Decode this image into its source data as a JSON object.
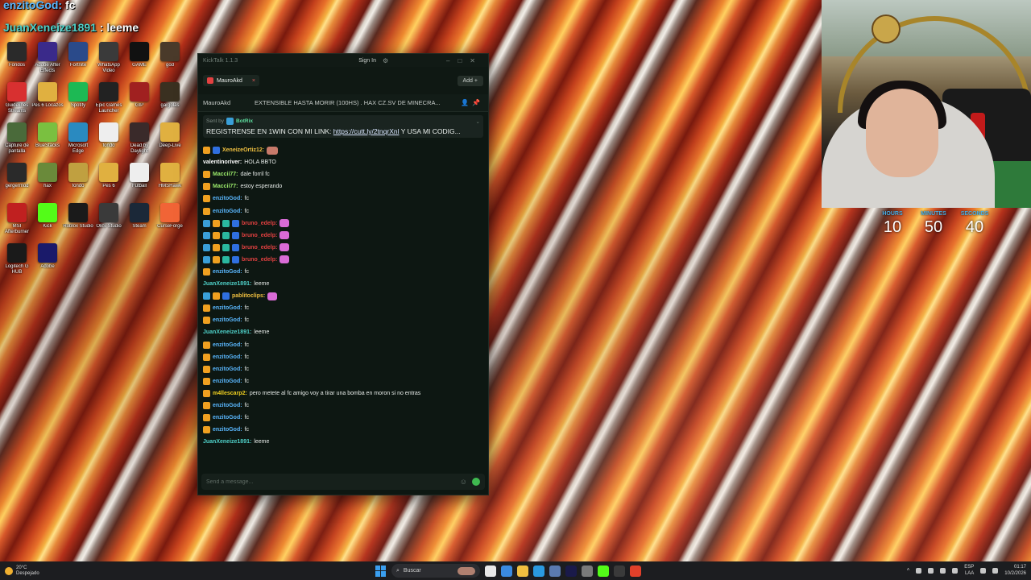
{
  "overlay": {
    "name1": "enzitoGod:",
    "name1_rest": "fc",
    "name2": "JuanXeneize1891",
    "name2_rest": ": leeme"
  },
  "chat": {
    "app_title": "KickTalk 1.1.3",
    "sign_in": "Sign In",
    "tab_label": "MauroAkd",
    "add_label": "Add +",
    "channel": "MauroAkd",
    "stream_title": "EXTENSIBLE HASTA MORIR (100HS) . HAX CZ.SV DE MINECRA...",
    "pinned": {
      "sent_by": "Sent by",
      "user": "BotRix",
      "text_before": "REGISTRENSE EN 1WIN CON MI LINK:",
      "link": "https://cutt.ly/2tnqrXnl",
      "text_after": "Y USA MI CODIG..."
    },
    "messages": [
      {
        "user": "XeneizeOrtiz12:",
        "text": "",
        "color": "#f0c040",
        "badges": [
          "crown",
          "gem"
        ],
        "emote": "face"
      },
      {
        "user": "valentinoriver:",
        "text": "HOLA BBTO",
        "color": "#ffffff",
        "badges": [],
        "emote": ""
      },
      {
        "user": "Maccii77:",
        "text": "dale forril fc",
        "color": "#9ae86a",
        "badges": [
          "crown"
        ],
        "emote": ""
      },
      {
        "user": "Maccii77:",
        "text": "estoy esperando",
        "color": "#9ae86a",
        "badges": [
          "crown"
        ],
        "emote": ""
      },
      {
        "user": "enzitoGod:",
        "text": "fc",
        "color": "#5ab8ff",
        "badges": [
          "crown"
        ],
        "emote": ""
      },
      {
        "user": "enzitoGod:",
        "text": "fc",
        "color": "#5ab8ff",
        "badges": [
          "crown"
        ],
        "emote": ""
      },
      {
        "user": "bruno_edelp:",
        "text": "",
        "color": "#e04040",
        "badges": [
          "blue",
          "crown",
          "teal",
          "gem"
        ],
        "emote": "pink"
      },
      {
        "user": "bruno_edelp:",
        "text": "",
        "color": "#e04040",
        "badges": [
          "blue",
          "crown",
          "teal",
          "gem"
        ],
        "emote": "pink"
      },
      {
        "user": "bruno_edelp:",
        "text": "",
        "color": "#e04040",
        "badges": [
          "blue",
          "crown",
          "teal",
          "gem"
        ],
        "emote": "pink"
      },
      {
        "user": "bruno_edelp:",
        "text": "",
        "color": "#e04040",
        "badges": [
          "blue",
          "crown",
          "teal",
          "gem"
        ],
        "emote": "pink"
      },
      {
        "user": "enzitoGod:",
        "text": "fc",
        "color": "#5ab8ff",
        "badges": [
          "crown"
        ],
        "emote": ""
      },
      {
        "user": "JuanXeneize1891:",
        "text": "leeme",
        "color": "#4fd0c8",
        "badges": [],
        "emote": ""
      },
      {
        "user": "pablitoclips:",
        "text": "",
        "color": "#f0c040",
        "badges": [
          "blue",
          "crown",
          "gem"
        ],
        "emote": "pink"
      },
      {
        "user": "enzitoGod:",
        "text": "fc",
        "color": "#5ab8ff",
        "badges": [
          "crown"
        ],
        "emote": ""
      },
      {
        "user": "enzitoGod:",
        "text": "fc",
        "color": "#5ab8ff",
        "badges": [
          "crown"
        ],
        "emote": ""
      },
      {
        "user": "JuanXeneize1891:",
        "text": "leeme",
        "color": "#4fd0c8",
        "badges": [],
        "emote": ""
      },
      {
        "user": "enzitoGod:",
        "text": "fc",
        "color": "#5ab8ff",
        "badges": [
          "crown"
        ],
        "emote": ""
      },
      {
        "user": "enzitoGod:",
        "text": "fc",
        "color": "#5ab8ff",
        "badges": [
          "crown"
        ],
        "emote": ""
      },
      {
        "user": "enzitoGod:",
        "text": "fc",
        "color": "#5ab8ff",
        "badges": [
          "crown"
        ],
        "emote": ""
      },
      {
        "user": "enzitoGod:",
        "text": "fc",
        "color": "#5ab8ff",
        "badges": [
          "crown"
        ],
        "emote": ""
      },
      {
        "user": "m4llescarp2:",
        "text": "pero metete al fc amigo voy a tirar una bomba en moron si no entras",
        "color": "#f0d020",
        "badges": [
          "crown"
        ],
        "emote": ""
      },
      {
        "user": "enzitoGod:",
        "text": "fc",
        "color": "#5ab8ff",
        "badges": [
          "crown"
        ],
        "emote": ""
      },
      {
        "user": "enzitoGod:",
        "text": "fc",
        "color": "#5ab8ff",
        "badges": [
          "crown"
        ],
        "emote": ""
      },
      {
        "user": "enzitoGod:",
        "text": "fc",
        "color": "#5ab8ff",
        "badges": [
          "crown"
        ],
        "emote": ""
      },
      {
        "user": "JuanXeneize1891:",
        "text": "leeme",
        "color": "#4fd0c8",
        "badges": [],
        "emote": ""
      }
    ],
    "input_placeholder": "Send a message..."
  },
  "timer": {
    "hours_label": "HOURS",
    "hours": "10",
    "minutes_label": "MINUTES",
    "minutes": "50",
    "seconds_label": "SECONDS",
    "seconds": "40"
  },
  "desktop_icons": [
    {
      "label": "Fondos",
      "color": "#2a2a2a"
    },
    {
      "label": "Adobe After Effects",
      "color": "#3a2a8a"
    },
    {
      "label": "Fortnite",
      "color": "#2a4a8a"
    },
    {
      "label": "WhatsApp Video",
      "color": "#3a3a3a"
    },
    {
      "label": "GAME",
      "color": "#111111"
    },
    {
      "label": "god",
      "color": "#4a3a2a"
    },
    {
      "label": "Guidelines Streams",
      "color": "#d83030"
    },
    {
      "label": "Pes 6 Locazos",
      "color": "#e0b040"
    },
    {
      "label": "Spotify",
      "color": "#1db954"
    },
    {
      "label": "Epic Games Launcher",
      "color": "#222222"
    },
    {
      "label": "GIP",
      "color": "#a02020"
    },
    {
      "label": "gargolas",
      "color": "#3a3020"
    },
    {
      "label": "Capture de pantalla",
      "color": "#4a6a3a"
    },
    {
      "label": "BlueStacks",
      "color": "#7ac040"
    },
    {
      "label": "Microsoft Edge",
      "color": "#2a8ac0"
    },
    {
      "label": "fondo",
      "color": "#eeeeee"
    },
    {
      "label": "Dead by Daylight",
      "color": "#3a2a2a"
    },
    {
      "label": "Deep-Live",
      "color": "#e0b040"
    },
    {
      "label": "gergermod",
      "color": "#2a2a2a"
    },
    {
      "label": "hax",
      "color": "#6a8a3a"
    },
    {
      "label": "fondo",
      "color": "#c0a040"
    },
    {
      "label": "Pes 6",
      "color": "#e0b040"
    },
    {
      "label": "Futball",
      "color": "#eeeeee"
    },
    {
      "label": "HMSHawk",
      "color": "#e0b040"
    },
    {
      "label": "MSI Afterburner",
      "color": "#c02020"
    },
    {
      "label": "Kick",
      "color": "#53fc18"
    },
    {
      "label": "Roblox Studio",
      "color": "#1a1a1a"
    },
    {
      "label": "OBS Studio",
      "color": "#3a3a3a"
    },
    {
      "label": "Steam",
      "color": "#1b2838"
    },
    {
      "label": "CurseForge",
      "color": "#f16436"
    },
    {
      "label": "Logitech G HUB",
      "color": "#1a1a1a"
    },
    {
      "label": "Adobe",
      "color": "#1a1a6a"
    }
  ],
  "taskbar": {
    "temp": "20°C",
    "weather": "Despejado",
    "search": "Buscar",
    "lang": "ESP",
    "lang2": "LAA",
    "time": "01:17",
    "date": "10/2/2026"
  }
}
